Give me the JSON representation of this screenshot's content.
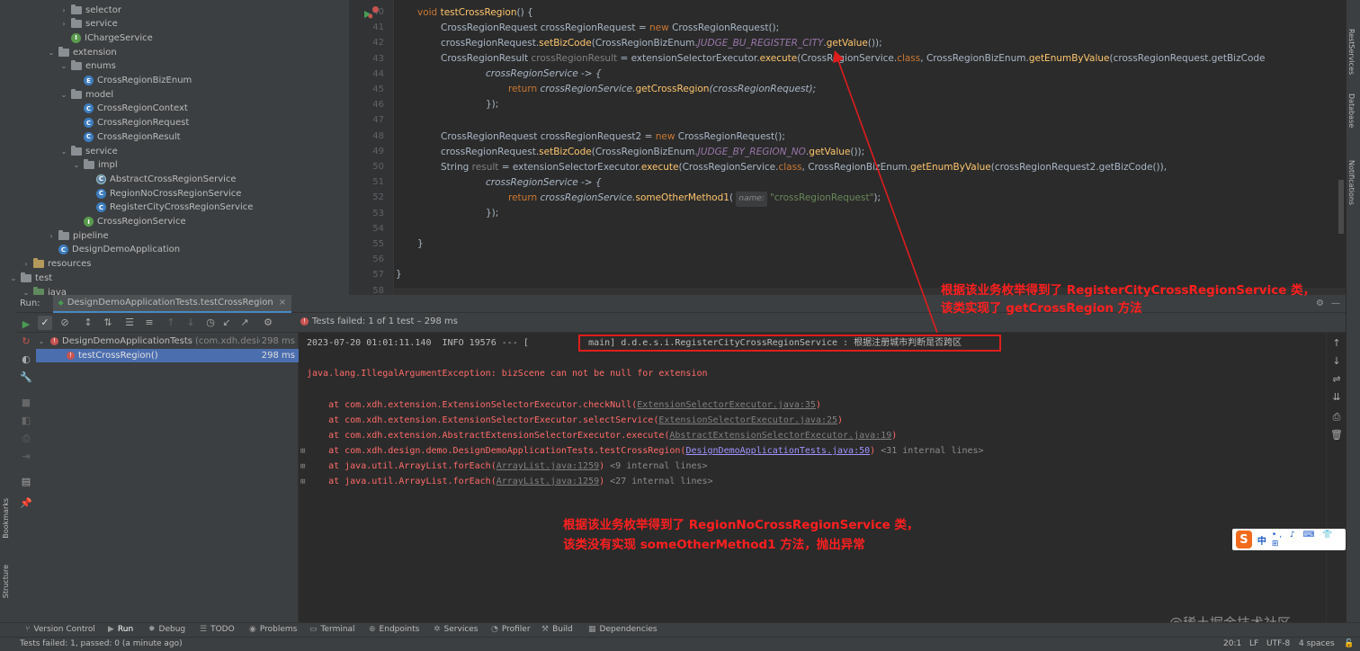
{
  "project_tree": [
    {
      "label": "selector",
      "type": "folder",
      "depth": 5,
      "arrow": "›"
    },
    {
      "label": "service",
      "type": "folder",
      "depth": 5,
      "arrow": "›"
    },
    {
      "label": "IChargeService",
      "type": "interface",
      "depth": 5,
      "arrow": ""
    },
    {
      "label": "extension",
      "type": "folder",
      "depth": 4,
      "arrow": "⌄"
    },
    {
      "label": "enums",
      "type": "folder",
      "depth": 5,
      "arrow": "⌄"
    },
    {
      "label": "CrossRegionBizEnum",
      "type": "enum",
      "depth": 6,
      "arrow": ""
    },
    {
      "label": "model",
      "type": "folder",
      "depth": 5,
      "arrow": "⌄"
    },
    {
      "label": "CrossRegionContext",
      "type": "class",
      "depth": 6,
      "arrow": ""
    },
    {
      "label": "CrossRegionRequest",
      "type": "class",
      "depth": 6,
      "arrow": ""
    },
    {
      "label": "CrossRegionResult",
      "type": "class",
      "depth": 6,
      "arrow": ""
    },
    {
      "label": "service",
      "type": "folder",
      "depth": 5,
      "arrow": "⌄"
    },
    {
      "label": "impl",
      "type": "folder",
      "depth": 6,
      "arrow": "⌄"
    },
    {
      "label": "AbstractCrossRegionService",
      "type": "abstract",
      "depth": 7,
      "arrow": ""
    },
    {
      "label": "RegionNoCrossRegionService",
      "type": "class",
      "depth": 7,
      "arrow": ""
    },
    {
      "label": "RegisterCityCrossRegionService",
      "type": "class",
      "depth": 7,
      "arrow": ""
    },
    {
      "label": "CrossRegionService",
      "type": "interface",
      "depth": 6,
      "arrow": ""
    },
    {
      "label": "pipeline",
      "type": "folder",
      "depth": 4,
      "arrow": "›"
    },
    {
      "label": "DesignDemoApplication",
      "type": "class",
      "depth": 4,
      "arrow": ""
    },
    {
      "label": "resources",
      "type": "resfolder",
      "depth": 2,
      "arrow": "›"
    },
    {
      "label": "test",
      "type": "folder",
      "depth": 1,
      "arrow": "⌄"
    },
    {
      "label": "java",
      "type": "testfolder",
      "depth": 2,
      "arrow": "⌄"
    }
  ],
  "editor": {
    "line_numbers": [
      "40",
      "41",
      "42",
      "43",
      "44",
      "45",
      "46",
      "47",
      "48",
      "49",
      "50",
      "51",
      "52",
      "53",
      "54",
      "55",
      "56",
      "57",
      "58"
    ],
    "method_name": "testCrossRegion",
    "void_kw": "void",
    "l41_type": "CrossRegionRequest",
    "l41_var": " crossRegionRequest = ",
    "l41_new": "new",
    "l41_ctor": " CrossRegionRequest",
    "l41_end": "();",
    "l42_a": "crossRegionRequest.",
    "l42_m": "setBizCode",
    "l42_b": "(CrossRegionBizEnum.",
    "l42_c": "JUDGE_BU_REGISTER_CITY",
    "l42_d": ".",
    "l42_e": "getValue",
    "l42_f": "());",
    "l43_type": "CrossRegionResult",
    "l43_var": " crossRegionResult",
    "l43_eq": " = extensionSelectorExecutor.",
    "l43_m": "execute",
    "l43_b": "(CrossRegionService.",
    "l43_cls": "class",
    "l43_c": ", CrossRegionBizEnum.",
    "l43_m2": "getEnumByValue",
    "l43_d": "(crossRegionRequest.getBizCode",
    "l44": "crossRegionService -> {",
    "l45_kw": "return",
    "l45_a": " crossRegionService.",
    "l45_m": "getCrossRegion",
    "l45_b": "(crossRegionRequest);",
    "l46": "});",
    "l48_type": "CrossRegionRequest",
    "l48_var": " crossRegionRequest2 = ",
    "l48_new": "new",
    "l48_ctor": " CrossRegionRequest",
    "l48_end": "();",
    "l49_a": "crossRegionRequest.",
    "l49_m": "setBizCode",
    "l49_b": "(CrossRegionBizEnum.",
    "l49_c": "JUDGE_BY_REGION_NO",
    "l49_d": ".",
    "l49_e": "getValue",
    "l49_f": "());",
    "l50_type": "String",
    "l50_var": " result",
    "l50_eq": " = extensionSelectorExecutor.",
    "l50_m": "execute",
    "l50_b": "(CrossRegionService.",
    "l50_cls": "class",
    "l50_c": ", CrossRegionBizEnum.",
    "l50_m2": "getEnumByValue",
    "l50_d": "(crossRegionRequest2.getBizCode()),",
    "l51": "crossRegionService -> {",
    "l52_kw": "return",
    "l52_a": " crossRegionService.",
    "l52_m": "someOtherMethod1",
    "l52_b": "( ",
    "l52_hint": "name:",
    "l52_str": "\"crossRegionRequest\"",
    "l52_c": ");",
    "l53": "});",
    "l55": "}",
    "l57": "}"
  },
  "run_panel": {
    "label": "Run:",
    "tab": "DesignDemoApplicationTests.testCrossRegion",
    "status": "Tests failed: 1 of 1 test – 298 ms",
    "tree_root": "DesignDemoApplicationTests",
    "tree_root_pkg": "(com.xdh.design.de",
    "tree_root_time": "298 ms",
    "tree_child": "testCrossRegion()",
    "tree_child_time": "298 ms"
  },
  "console": {
    "log_line": "2023-07-20 01:01:11.140  INFO 19576 --- [           main] d.d.e.s.i.RegisterCityCrossRegionService : 根据注册城市判断是否跨区",
    "exception": "java.lang.IllegalArgumentException: bizScene can not be null for extension",
    "st1_a": "    at com.xdh.extension.ExtensionSelectorExecutor.checkNull(",
    "st1_l": "ExtensionSelectorExecutor.java:35",
    "st2_a": "    at com.xdh.extension.ExtensionSelectorExecutor.selectService(",
    "st2_l": "ExtensionSelectorExecutor.java:25",
    "st3_a": "    at com.xdh.extension.AbstractExtensionSelectorExecutor.execute(",
    "st3_l": "AbstractExtensionSelectorExecutor.java:19",
    "st4_a": "    at com.xdh.design.demo.DesignDemoApplicationTests.testCrossRegion(",
    "st4_l": "DesignDemoApplicationTests.java:50",
    "st4_g": " <31 internal lines>",
    "st5_a": "    at java.util.ArrayList.forEach(",
    "st5_l": "ArrayList.java:1259",
    "st5_g": " <9 internal lines>",
    "st6_a": "    at java.util.ArrayList.forEach(",
    "st6_l": "ArrayList.java:1259",
    "st6_g": " <27 internal lines>",
    "close_paren": ")"
  },
  "annotations": {
    "top_1": "根据该业务枚举得到了 RegisterCityCrossRegionService 类，",
    "top_2": "该类实现了 getCrossRegion 方法",
    "bottom_1": "根据该业务枚举得到了 RegionNoCrossRegionService 类，",
    "bottom_2": "该类没有实现 someOtherMethod1 方法，抛出异常"
  },
  "right_tabs": [
    "RestServices",
    "Database",
    "Notifications"
  ],
  "left_tabs": [
    "Bookmarks",
    "Structure"
  ],
  "bottom_tabs": [
    "Version Control",
    "Run",
    "Debug",
    "TODO",
    "Problems",
    "Terminal",
    "Endpoints",
    "Services",
    "Profiler",
    "Build",
    "Dependencies"
  ],
  "status_bar": {
    "message": "Tests failed: 1, passed: 0 (a minute ago)",
    "position": "20:1",
    "line_sep": "LF",
    "encoding": "UTF-8",
    "indent": "4 spaces"
  },
  "watermark": "@稀土掘金技术社区",
  "ime": {
    "logo": "S",
    "lang": "中",
    "icons": "•, ♪ ⌨ 👕 ⊞"
  },
  "colors": {
    "annotation_red": "#ff1f1f",
    "error": "#ff6b68",
    "accent": "#4a88c7"
  }
}
